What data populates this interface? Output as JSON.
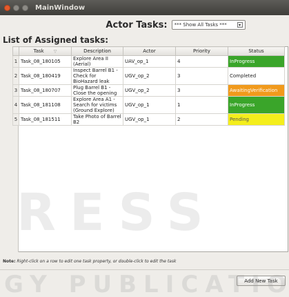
{
  "window": {
    "title": "MainWindow"
  },
  "header": {
    "label": "Actor Tasks:",
    "filter_value": "*** Show All Tasks ***"
  },
  "list_title": "List of Assigned tasks:",
  "table": {
    "columns": [
      "Task",
      "Description",
      "Actor",
      "Priority",
      "Status"
    ],
    "rows": [
      {
        "num": "1",
        "task": "Task_08_180105",
        "description": "Explore Area II (Aerial)",
        "actor": "UAV_op_1",
        "priority": "4",
        "status": "InProgress",
        "status_color": "#3aa52a"
      },
      {
        "num": "2",
        "task": "Task_08_180419",
        "description": "Inspect Barrel B1 - Check for BioHazard leak",
        "actor": "UGV_op_2",
        "priority": "3",
        "status": "Completed",
        "status_color": "#ffffff"
      },
      {
        "num": "3",
        "task": "Task_08_180707",
        "description": "Plug Barrel B1 - Close the opening",
        "actor": "UGV_op_2",
        "priority": "3",
        "status": "AwaitingVerification",
        "status_color": "#f19a1c"
      },
      {
        "num": "4",
        "task": "Task_08_181108",
        "description": "Explore Area A1 - Search for victims (Ground Explore)",
        "actor": "UGV_op_1",
        "priority": "1",
        "status": "InProgress",
        "status_color": "#3aa52a"
      },
      {
        "num": "5",
        "task": "Task_08_181511",
        "description": "Take Photo of Barrel B2",
        "actor": "UGV_op_1",
        "priority": "2",
        "status": "Pending",
        "status_color": "#f4ee1c"
      }
    ]
  },
  "note": {
    "prefix": "Note:",
    "text": "Right-click on a row to edit one task property, or double-click to edit the task"
  },
  "add_button": "Add New Task",
  "watermarks": {
    "big": "RESS",
    "small": "GY PUBLICATIO"
  }
}
